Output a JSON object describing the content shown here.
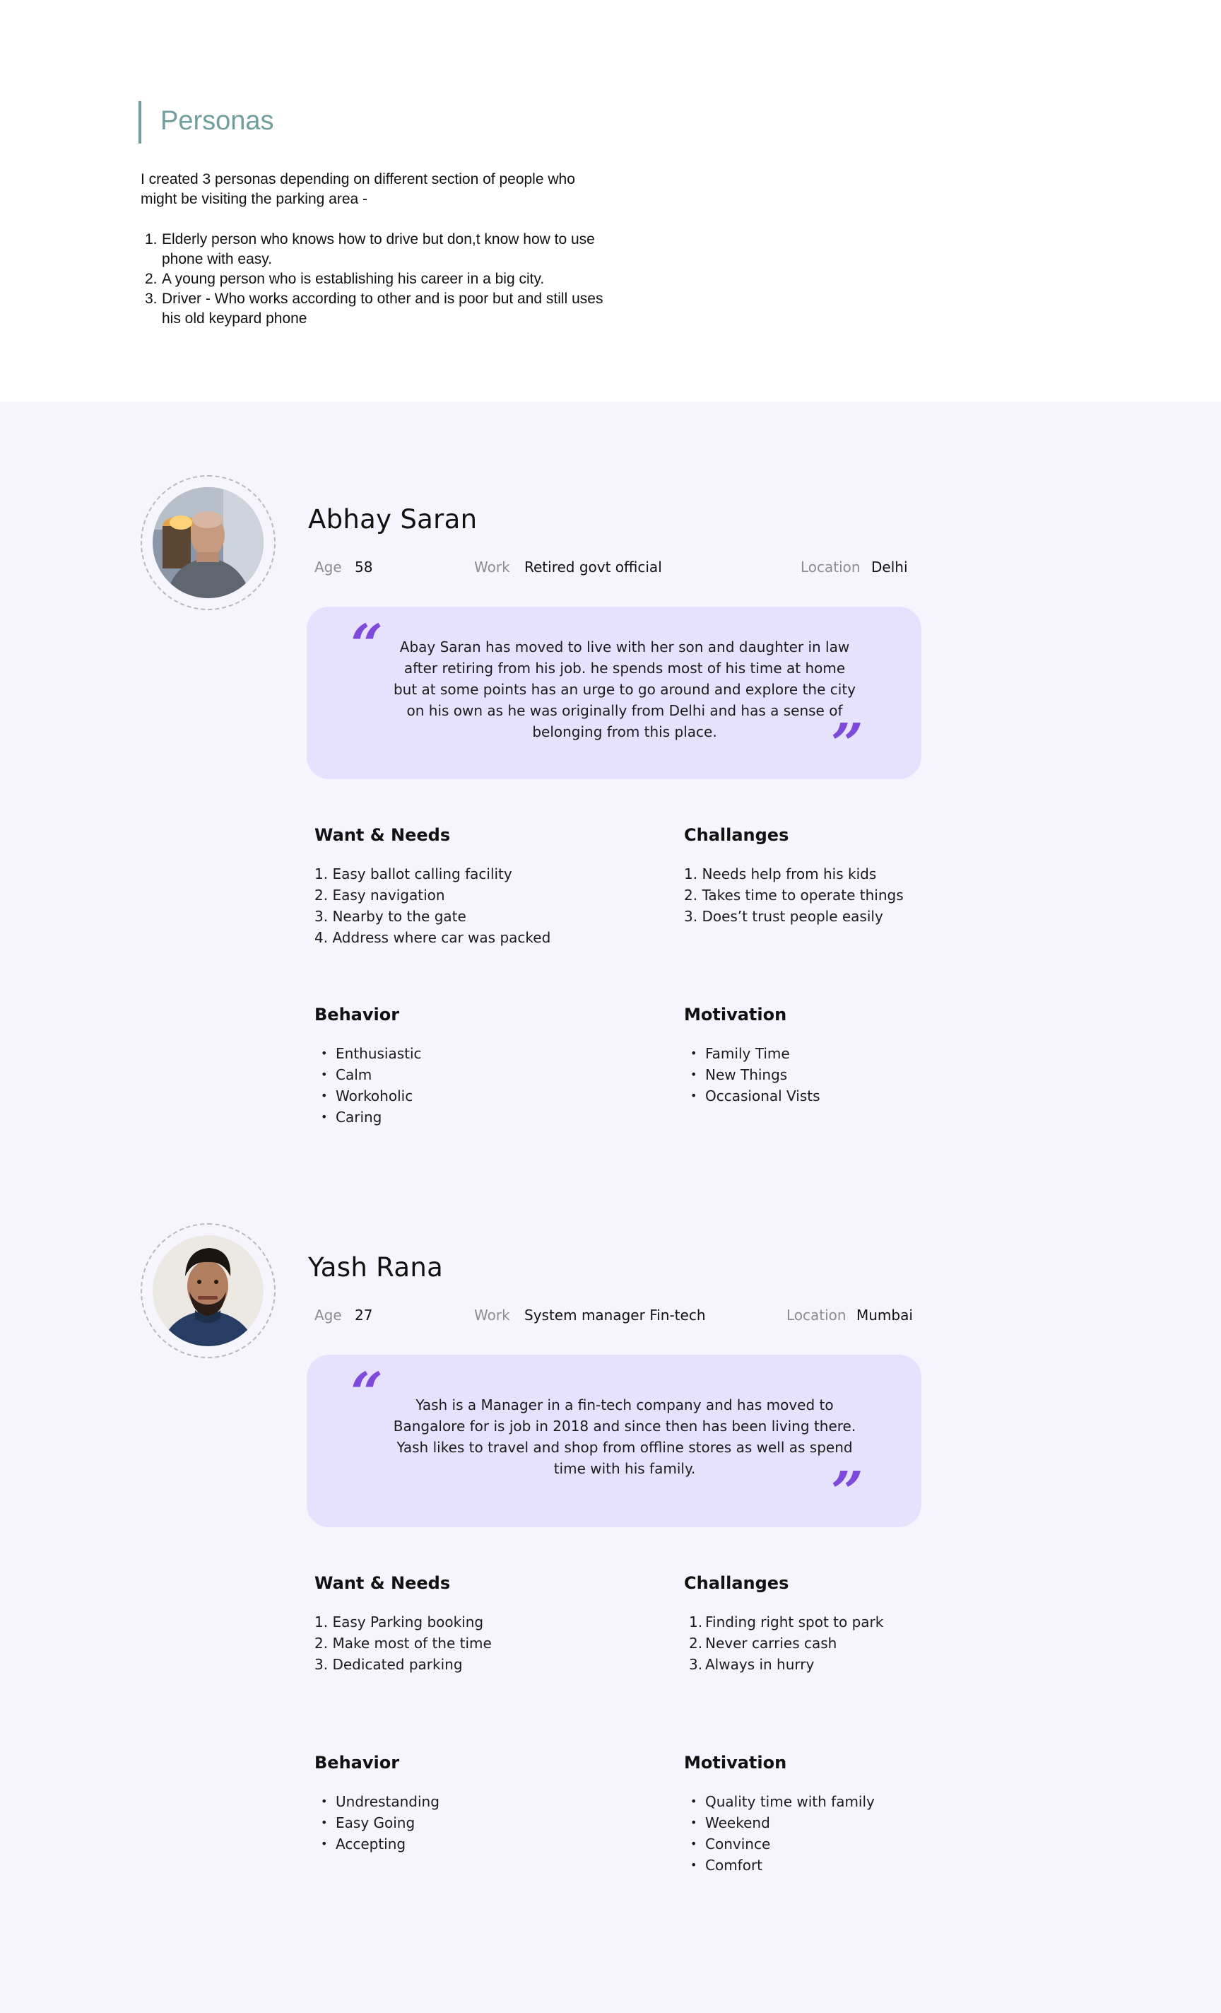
{
  "intro": {
    "title": "Personas",
    "text": "I created 3 personas depending on different section of people who might be visiting the parking area -",
    "items": [
      "Elderly person who knows how to drive but don,t know how to use phone with easy.",
      "A young person who is establishing his career in a big city.",
      "Driver - Who works according to other and is poor but and still uses his old keypard phone"
    ]
  },
  "labels": {
    "age": "Age",
    "work": "Work",
    "location": "Location",
    "wants": "Want & Needs",
    "challenges": "Challanges",
    "behavior": "Behavior",
    "motivation": "Motivation"
  },
  "personas": [
    {
      "name": "Abhay Saran",
      "age": "58",
      "work": "Retired govt official",
      "location": "Delhi",
      "quote": "Abay Saran has moved to live with her son and daughter in law after retiring from his job. he spends most of his time at home but at some points has an urge to go around and explore the city on his own as he was originally from Delhi and has a sense of belonging from this place.",
      "wants": [
        "1. Easy ballot calling facility",
        "2. Easy navigation",
        "3. Nearby to the gate",
        "4. Address where car was packed"
      ],
      "challenges": [
        "1. Needs help from his kids",
        "2. Takes time to operate things",
        "3. Does’t trust people easily"
      ],
      "behavior": [
        "Enthusiastic",
        "Calm",
        "Workoholic",
        "Caring"
      ],
      "motivation": [
        "Family Time",
        "New Things",
        "Occasional Vists"
      ]
    },
    {
      "name": "Yash Rana",
      "age": "27",
      "work": "System manager Fin-tech",
      "location": "Mumbai",
      "quote": "Yash is a Manager in a fin-tech company and has moved to Bangalore for is job in 2018 and since then has been living there. Yash likes to travel and shop from offline stores as well as spend time with his family.",
      "wants": [
        "1. Easy Parking booking",
        "2. Make most of the time",
        "3. Dedicated parking"
      ],
      "challenges": [
        "Finding right spot to park",
        "Never carries cash",
        "Always in hurry"
      ],
      "behavior": [
        "Undrestanding",
        "Easy Going",
        "Accepting"
      ],
      "motivation": [
        "Quality time with family",
        "Weekend",
        "Convince",
        "Comfort"
      ]
    }
  ],
  "colors": {
    "accent_teal": "#6f9e9c",
    "quote_purple": "#7d4ad9",
    "card_lavender": "#e6e2fd",
    "section_bg": "#f6f5fd"
  }
}
